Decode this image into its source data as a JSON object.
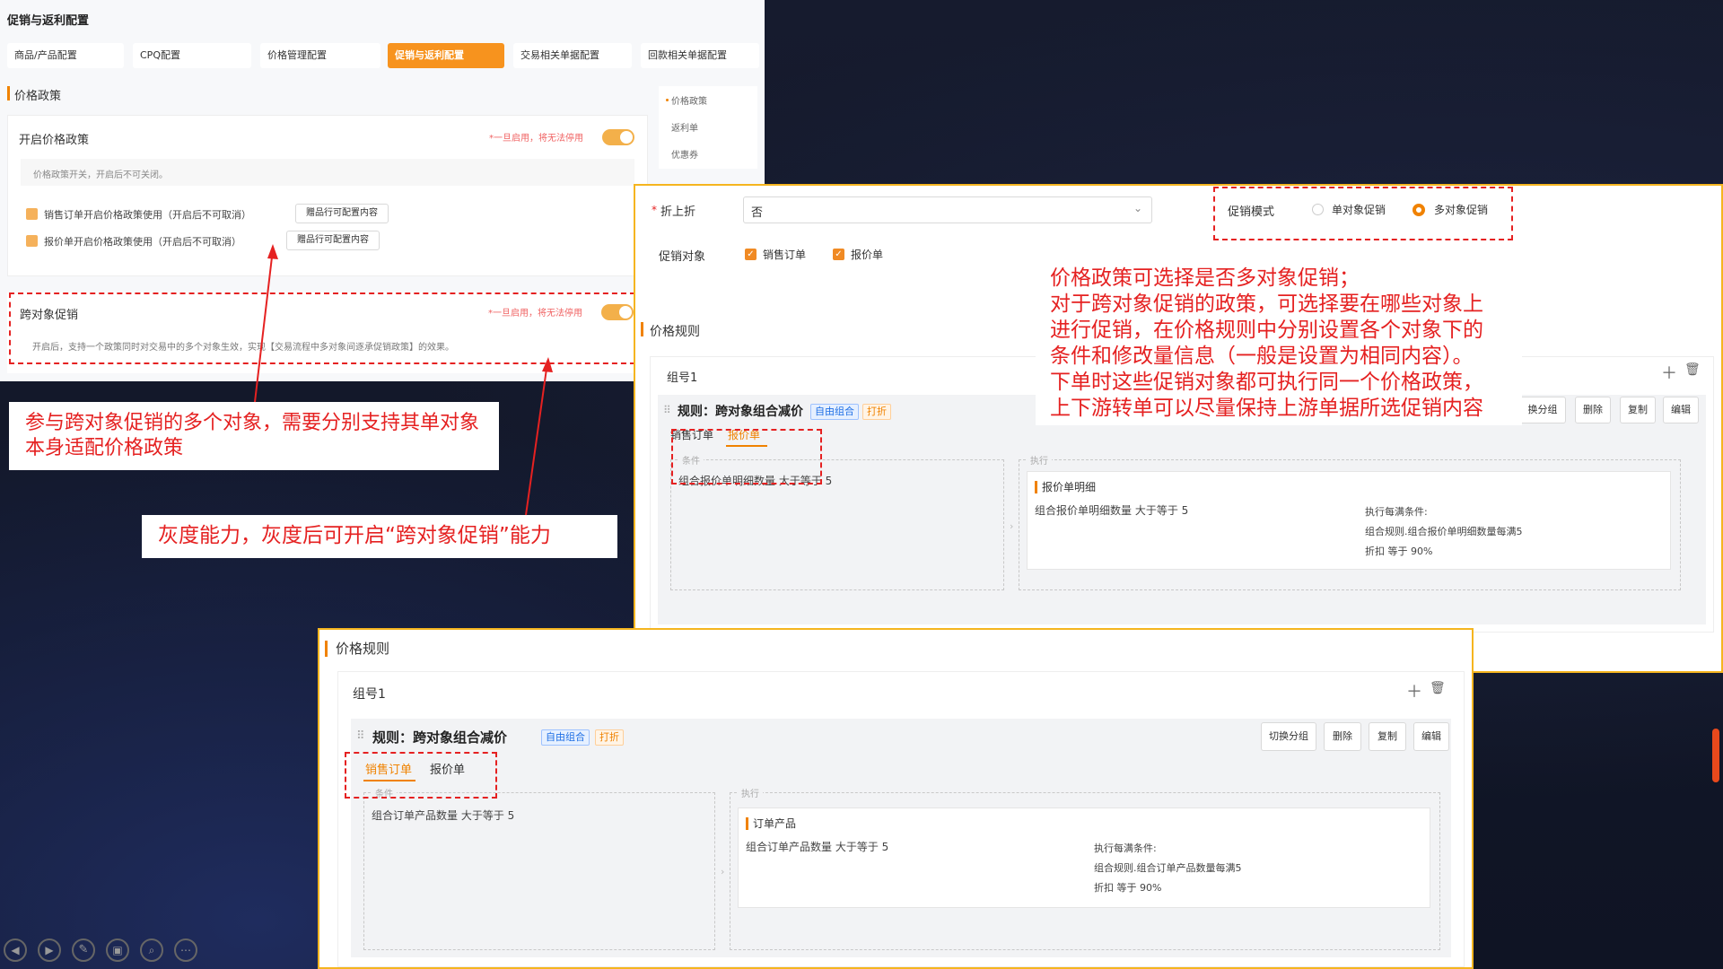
{
  "left_panel": {
    "title": "促销与返利配置",
    "tabs": [
      {
        "label": "商品/产品配置",
        "active": false
      },
      {
        "label": "CPQ配置",
        "active": false
      },
      {
        "label": "价格管理配置",
        "active": false
      },
      {
        "label": "促销与返利配置",
        "active": true
      },
      {
        "label": "交易相关单据配置",
        "active": false
      },
      {
        "label": "回款相关单据配置",
        "active": false
      }
    ],
    "section_title": "价格政策",
    "side_nav": [
      "价格政策",
      "返利单",
      "优惠券"
    ],
    "enable_block": {
      "title": "开启价格政策",
      "warning": "*一旦启用，将无法停用",
      "desc": "价格政策开关，开启后不可关闭。",
      "options": [
        {
          "label": "销售订单开启价格政策使用（开启后不可取消）",
          "button": "赠品行可配置内容"
        },
        {
          "label": "报价单开启价格政策使用（开启后不可取消）",
          "button": "赠品行可配置内容"
        }
      ]
    },
    "cross_block": {
      "title": "跨对象促销",
      "warning": "*一旦启用，将无法停用",
      "desc": "开启后，支持一个政策同时对交易中的多个对象生效，实现【交易流程中多对象间逐承促销政策】的效果。"
    }
  },
  "notes": {
    "note1": "参与跨对象促销的多个对象，需要分别支持其单对象本身适配价格政策",
    "note2": "灰度能力，灰度后可开启“跨对象促销”能力",
    "note3_lines": [
      "价格政策可选择是否多对象促销；",
      "对于跨对象促销的政策，可选择要在哪些对象上",
      "进行促销，在价格规则中分别设置各个对象下的",
      "条件和修改量信息（一般是设置为相同内容）。",
      "下单时这些促销对象都可执行同一个价格政策，",
      "上下游转单可以尽量保持上游单据所选促销内容"
    ]
  },
  "right_panel": {
    "discount_label": "折上折",
    "discount_value": "否",
    "promo_mode_label": "促销模式",
    "mode_single": "单对象促销",
    "mode_multi": "多对象促销",
    "promo_target_label": "促销对象",
    "target_sales": "销售订单",
    "target_quote": "报价单",
    "price_rule_title": "价格规则",
    "group": "组号1",
    "rule_title": "规则：跨对象组合减价",
    "tag_free": "自由组合",
    "tag_discount": "打折",
    "tab_sales": "销售订单",
    "tab_quote": "报价单",
    "cond_label": "条件",
    "cond_text": "组合报价单明细数量 大于等于 5",
    "exec_label": "执行",
    "exec_title": "报价单明细",
    "exec_cond": "组合报价单明细数量 大于等于 5",
    "exec_right": [
      "执行每满条件:",
      "组合规则.组合报价单明细数量每满5",
      "折扣 等于 90%"
    ],
    "actions": [
      "换分组",
      "删除",
      "复制",
      "编辑"
    ]
  },
  "bottom_panel": {
    "price_rule_title": "价格规则",
    "group": "组号1",
    "rule_title": "规则：跨对象组合减价",
    "tag_free": "自由组合",
    "tag_discount": "打折",
    "tab_sales": "销售订单",
    "tab_quote": "报价单",
    "cond_label": "条件",
    "cond_text": "组合订单产品数量 大于等于 5",
    "exec_label": "执行",
    "exec_title": "订单产品",
    "exec_cond": "组合订单产品数量 大于等于 5",
    "exec_right": [
      "执行每满条件:",
      "组合规则.组合订单产品数量每满5",
      "折扣 等于 90%"
    ],
    "actions": [
      "切换分组",
      "删除",
      "复制",
      "编辑"
    ]
  },
  "player_controls": [
    "prev-icon",
    "next-icon",
    "pen-icon",
    "layout-icon",
    "zoom-icon",
    "more-icon"
  ]
}
